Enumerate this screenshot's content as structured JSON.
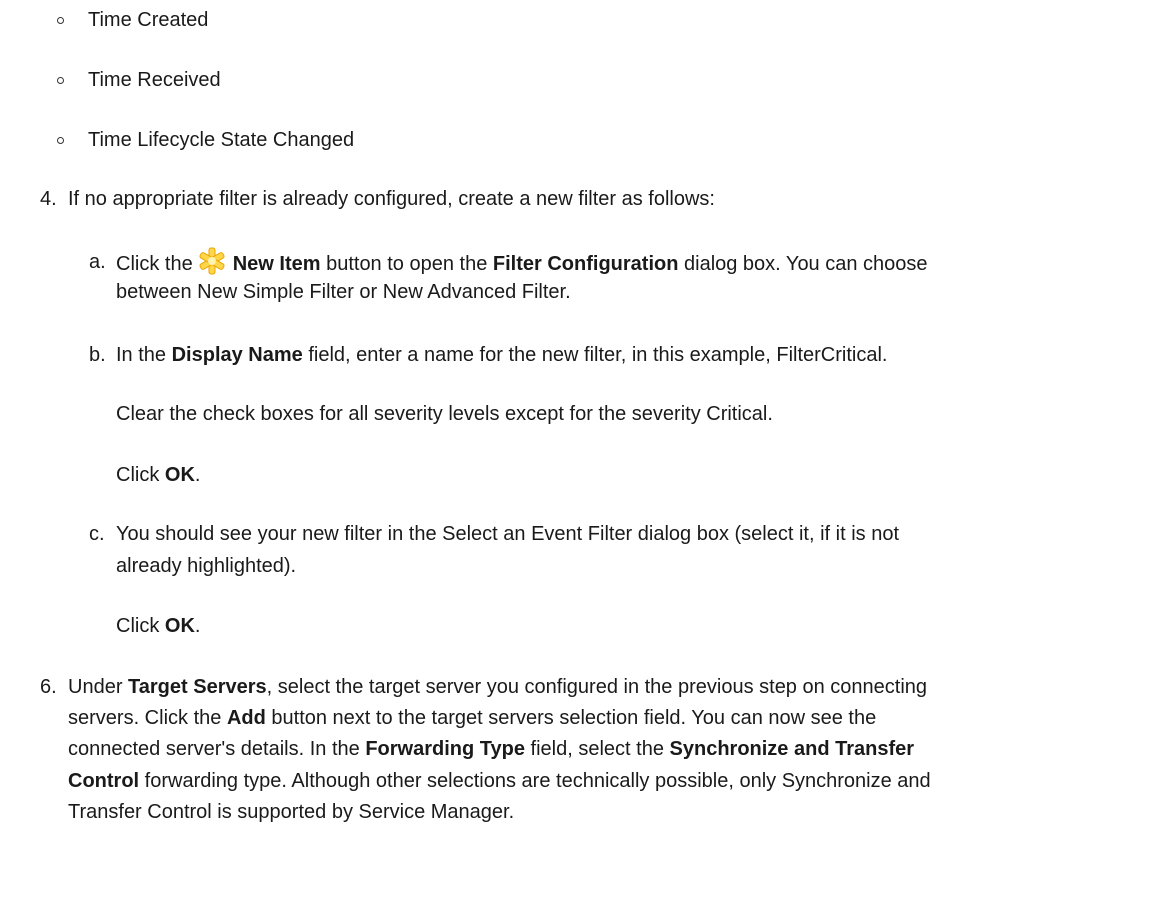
{
  "bullets": [
    "Time Created",
    "Time Received",
    "Time Lifecycle State Changed"
  ],
  "step4": {
    "num": "4.",
    "text": "If no appropriate filter is already configured, create a new filter as follows:"
  },
  "step_a": {
    "num": "a.",
    "t1": "Click the",
    "b1": "New Item",
    "t2": "button to open the",
    "b2": "Filter Configuration",
    "t3": "dialog box. You can choose",
    "line2": "between New Simple Filter or New Advanced Filter."
  },
  "step_b": {
    "num": "b.",
    "t1": "In the",
    "b1": "Display Name",
    "t2": "field, enter a name for the new filter, in this example, FilterCritical.",
    "p2": "Clear the check boxes for all severity levels except for the severity Critical.",
    "p3a": "Click",
    "p3b": "OK",
    "p3c": "."
  },
  "step_c": {
    "num": "c.",
    "line1": "You should see your new filter in the Select an Event Filter dialog box (select it, if it is not",
    "line2": "already highlighted).",
    "p2a": "Click",
    "p2b": "OK",
    "p2c": "."
  },
  "step6": {
    "num": "6.",
    "t1": "Under",
    "b1": "Target Servers",
    "t2": ", select the target server you configured in the previous step on connecting",
    "l2a": "servers. Click the",
    "l2b": "Add",
    "l2c": "button next to the target servers selection field. You can now see the",
    "l3a": "connected server's details. In the",
    "l3b": "Forwarding Type",
    "l3c": "field, select the",
    "l3d": "Synchronize and Transfer",
    "l4a": "Control",
    "l4b": "forwarding type. Although other selections are technically possible, only Synchronize and",
    "l5": "Transfer Control is supported by Service Manager."
  },
  "icons": {
    "new_item": "new-item-asterisk-icon",
    "color": "#f5b800"
  }
}
